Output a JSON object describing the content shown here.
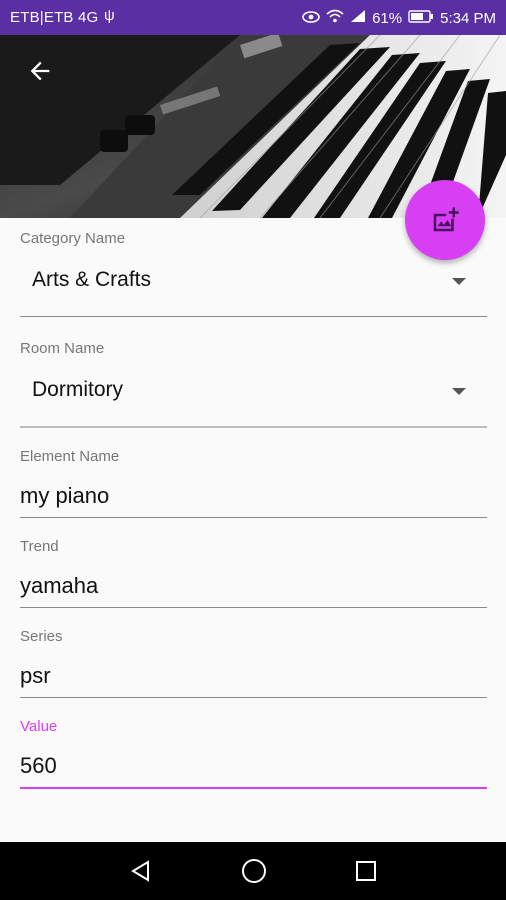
{
  "status_bar": {
    "carrier": "ETB|ETB 4G",
    "usb_icon": "usb-icon",
    "battery_percent": "61%",
    "time": "5:34 PM",
    "icons": [
      "eye-icon",
      "wifi-icon",
      "signal-icon",
      "battery-icon"
    ]
  },
  "header": {
    "back_icon": "arrow-left-icon",
    "image": "piano-keyboard-photo",
    "fab_icon": "add-photo-icon"
  },
  "form": {
    "category": {
      "label": "Category Name",
      "value": "Arts & Crafts"
    },
    "room": {
      "label": "Room Name",
      "value": "Dormitory"
    },
    "element": {
      "label": "Element Name",
      "value": "my piano"
    },
    "trend": {
      "label": "Trend",
      "value": "yamaha"
    },
    "series": {
      "label": "Series",
      "value": "psr"
    },
    "value": {
      "label": "Value",
      "value": "560"
    }
  },
  "nav_bar": {
    "icons": [
      "back-triangle-icon",
      "home-circle-icon",
      "recents-square-icon"
    ]
  },
  "colors": {
    "status_bar": "#5a2fa3",
    "accent": "#d63ff2",
    "background": "#fafafa",
    "nav_bar": "#000000"
  }
}
